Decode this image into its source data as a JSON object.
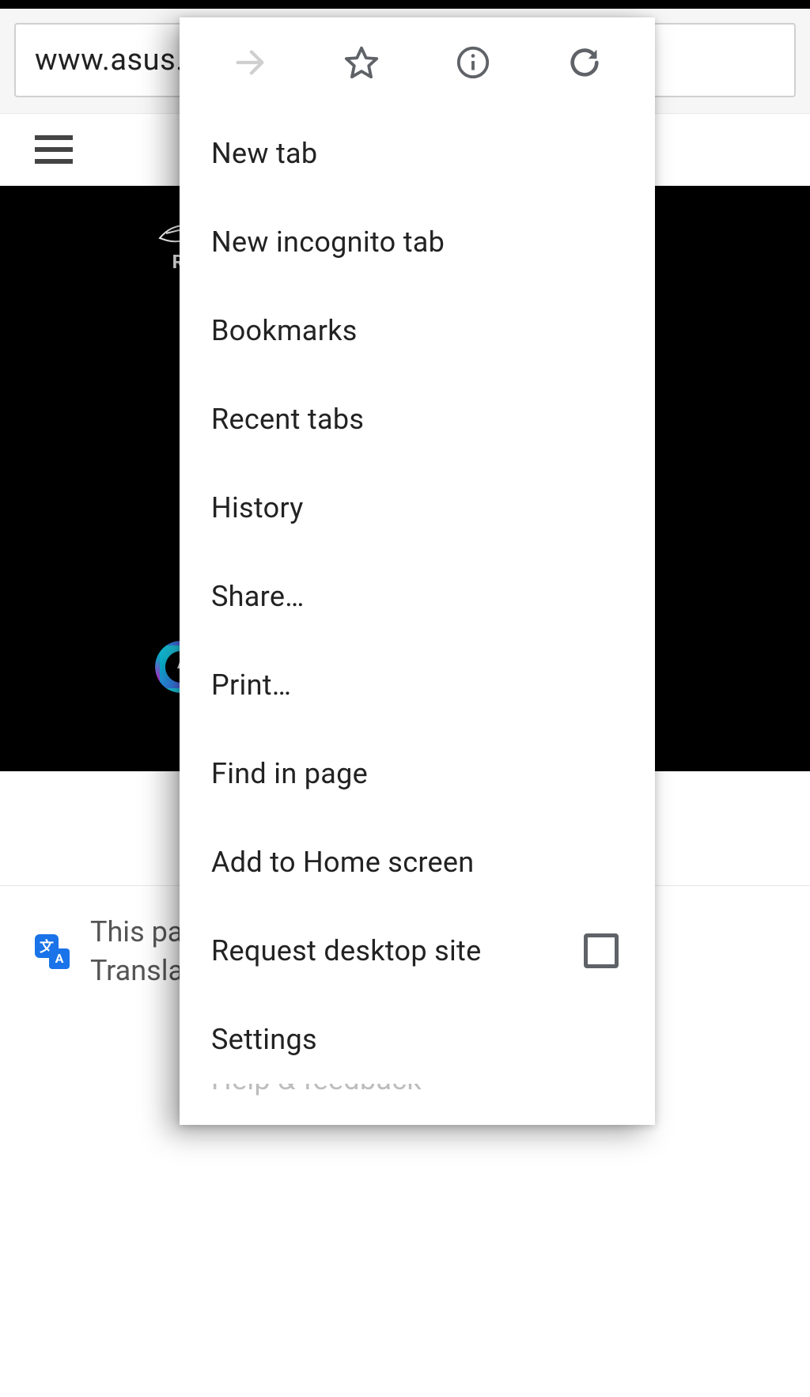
{
  "address_bar": {
    "url": "www.asus."
  },
  "page": {
    "rog_text": "RE",
    "aura_letter": "A"
  },
  "translate_bar": {
    "line1": "This pa",
    "line2": "Transla"
  },
  "menu": {
    "items": [
      {
        "label": "New tab"
      },
      {
        "label": "New incognito tab"
      },
      {
        "label": "Bookmarks"
      },
      {
        "label": "Recent tabs"
      },
      {
        "label": "History"
      },
      {
        "label": "Share…"
      },
      {
        "label": "Print…"
      },
      {
        "label": "Find in page"
      },
      {
        "label": "Add to Home screen"
      },
      {
        "label": "Request desktop site",
        "checkbox": true
      },
      {
        "label": "Settings"
      }
    ],
    "cut_item": "Help & feedback"
  }
}
